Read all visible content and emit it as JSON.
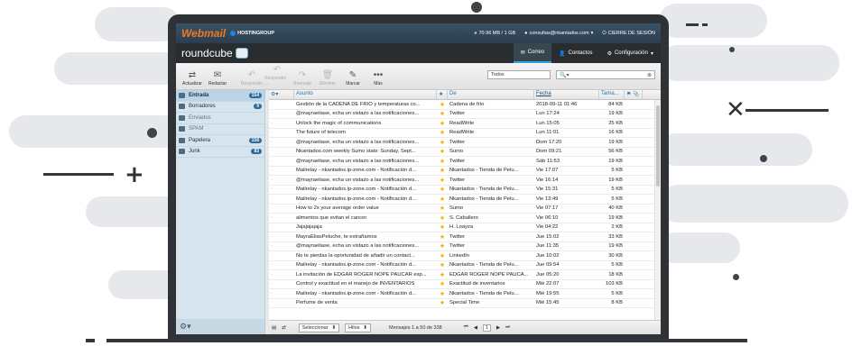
{
  "header": {
    "brand": "Webmail",
    "host": "HOSTINGROUP",
    "quota": "70.96 MB / 1 GB",
    "user": "consultas@nkantados.com",
    "logout": "CIERRE DE SESIÓN"
  },
  "nav": {
    "logo": "roundcube",
    "tabs": [
      {
        "label": "Correo"
      },
      {
        "label": "Contactos"
      },
      {
        "label": "Configuración"
      }
    ]
  },
  "toolbar": {
    "buttons": [
      {
        "label": "Actualizar"
      },
      {
        "label": "Redactar"
      },
      {
        "label": "Responder"
      },
      {
        "label": "Responder ..."
      },
      {
        "label": "Reenviar"
      },
      {
        "label": "Eliminar"
      },
      {
        "label": "Marcar"
      },
      {
        "label": "Más"
      }
    ],
    "filter": "Todos",
    "search_placeholder": ""
  },
  "folders": [
    {
      "name": "Entrada",
      "count": "154"
    },
    {
      "name": "Borradores",
      "count": "9"
    },
    {
      "name": "Enviados",
      "count": ""
    },
    {
      "name": "SPAM",
      "count": ""
    },
    {
      "name": "Papelera",
      "count": "158"
    },
    {
      "name": "Junk",
      "count": "83"
    }
  ],
  "columns": {
    "subject": "Asunto",
    "from": "De",
    "date": "Fecha",
    "size": "Tama..."
  },
  "messages": [
    {
      "subject": "Gestión de la CADENA DE FRÍO y temperaturas co...",
      "from": "Cadena de frío",
      "date": "2018-09-11 01:46",
      "size": "84 KB"
    },
    {
      "subject": "@mayraeliase, echa un vistazo a las notificaciones...",
      "from": "Twitter",
      "date": "Lun 17:24",
      "size": "19 KB"
    },
    {
      "subject": "Unlock the magic of communications",
      "from": "ReadWrite",
      "date": "Lun 15:05",
      "size": "25 KB"
    },
    {
      "subject": "The future of telecom",
      "from": "ReadWrite",
      "date": "Lun 11:01",
      "size": "16 KB"
    },
    {
      "subject": "@mayraeliase, echa un vistazo a las notificaciones...",
      "from": "Twitter",
      "date": "Dom 17:20",
      "size": "19 KB"
    },
    {
      "subject": "Nkantados.com weekly Sumo stats: Sunday, Sept...",
      "from": "Sumo",
      "date": "Dom 09:21",
      "size": "56 KB"
    },
    {
      "subject": "@mayraeliase, echa un vistazo a las notificaciones...",
      "from": "Twitter",
      "date": "Sáb 11:53",
      "size": "19 KB"
    },
    {
      "subject": "Mailrelay - nkantados.ip-zone.com - Notificación d...",
      "from": "Nkantados - Tienda de Pelu...",
      "date": "Vie 17:07",
      "size": "5 KB"
    },
    {
      "subject": "@mayraeliase, echa un vistazo a las notificaciones...",
      "from": "Twitter",
      "date": "Vie 16:14",
      "size": "19 KB"
    },
    {
      "subject": "Mailrelay - nkantados.ip-zone.com - Notificación d...",
      "from": "Nkantados - Tienda de Pelu...",
      "date": "Vie 15:31",
      "size": "5 KB"
    },
    {
      "subject": "Mailrelay - nkantados.ip-zone.com - Notificación d...",
      "from": "Nkantados - Tienda de Pelu...",
      "date": "Vie 13:49",
      "size": "5 KB"
    },
    {
      "subject": "How to 2x your average order value",
      "from": "Sumo",
      "date": "Vie 07:17",
      "size": "40 KB"
    },
    {
      "subject": "alimentos que evitan el cancer",
      "from": "S. Caballero",
      "date": "Vie 06:10",
      "size": "19 KB"
    },
    {
      "subject": "Jajajajajaja",
      "from": "H. Loayza",
      "date": "Vie 04:22",
      "size": "2 KB"
    },
    {
      "subject": "MayraEliasPeluche, te extrañamos",
      "from": "Twitter",
      "date": "Jue 15:02",
      "size": "33 KB"
    },
    {
      "subject": "@mayraeliase, echa un vistazo a las notificaciones...",
      "from": "Twitter",
      "date": "Jue 11:35",
      "size": "19 KB"
    },
    {
      "subject": "No te pierdas la oportunidad de añadir un contact...",
      "from": "LinkedIn",
      "date": "Jue 10:02",
      "size": "30 KB"
    },
    {
      "subject": "Mailrelay - nkantados.ip-zone.com - Notificación d...",
      "from": "Nkantados - Tienda de Pelu...",
      "date": "Jue 09:54",
      "size": "5 KB"
    },
    {
      "subject": "La invitación de EDGAR ROGER ÑOPE PAUCAR esp...",
      "from": "EDGAR ROGER ÑOPE PAUCA...",
      "date": "Jue 05:20",
      "size": "18 KB"
    },
    {
      "subject": "Control y exactitud en el manejo de INVENTARIOS",
      "from": "Exactitud de inventarios",
      "date": "Mié 22:07",
      "size": "103 KB"
    },
    {
      "subject": "Mailrelay - nkantados.ip-zone.com - Notificación d...",
      "from": "Nkantados - Tienda de Pelu...",
      "date": "Mié 19:55",
      "size": "5 KB"
    },
    {
      "subject": "Perfume de venta",
      "from": "Special Time",
      "date": "Mié 15:45",
      "size": "8 KB"
    }
  ],
  "footer": {
    "select": "Seleccionar",
    "threads": "Hilos",
    "count": "Mensajes 1 a 50 de 338",
    "page": "1"
  }
}
